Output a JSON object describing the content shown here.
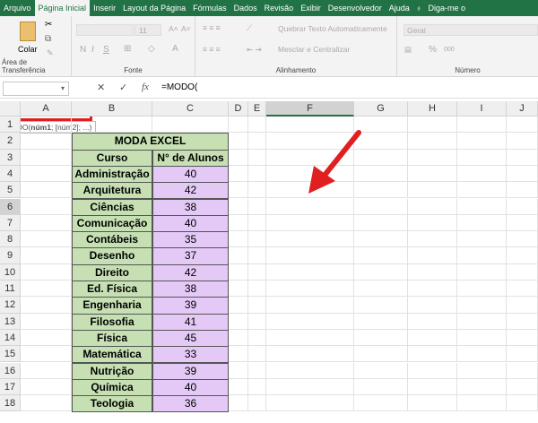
{
  "tabs": [
    "Arquivo",
    "Página Inicial",
    "Inserir",
    "Layout da Página",
    "Fórmulas",
    "Dados",
    "Revisão",
    "Exibir",
    "Desenvolvedor",
    "Ajuda",
    "Diga-me o"
  ],
  "ribbon": {
    "paste": "Colar",
    "clipboard": "Área de Transferência",
    "font_size": "11",
    "font": "Fonte",
    "bold": "N",
    "italic": "I",
    "underline": "S",
    "wrap": "Quebrar Texto Automaticamente",
    "merge": "Mesclar e Centralizar",
    "alignment": "Alinhamento",
    "number_format": "Geral",
    "number": "Número",
    "percent": "%",
    "thousands": "000"
  },
  "formula_bar": {
    "name_box": "",
    "fx": "fx",
    "formula": "=MODO("
  },
  "columns": [
    "A",
    "B",
    "C",
    "D",
    "E",
    "F",
    "G",
    "H",
    "I",
    "J"
  ],
  "rows": [
    "1",
    "2",
    "3",
    "4",
    "5",
    "6",
    "7",
    "8",
    "9",
    "10",
    "11",
    "12",
    "13",
    "14",
    "15",
    "16",
    "17",
    "18"
  ],
  "table": {
    "title": "MODA EXCEL",
    "headers": [
      "Curso",
      "N° de Alunos"
    ],
    "data": [
      [
        "Administração",
        "40"
      ],
      [
        "Arquitetura",
        "42"
      ],
      [
        "Ciências",
        "38"
      ],
      [
        "Comunicação",
        "40"
      ],
      [
        "Contábeis",
        "35"
      ],
      [
        "Desenho",
        "37"
      ],
      [
        "Direito",
        "42"
      ],
      [
        "Ed. Física",
        "38"
      ],
      [
        "Engenharia",
        "39"
      ],
      [
        "Filosofia",
        "41"
      ],
      [
        "Física",
        "45"
      ],
      [
        "Matemática",
        "33"
      ],
      [
        "Nutrição",
        "39"
      ],
      [
        "Química",
        "40"
      ],
      [
        "Teologia",
        "36"
      ]
    ]
  },
  "active_cell": {
    "value": "=MODO(",
    "tooltip_fn": "MODO(",
    "tooltip_arg1": "núm1",
    "tooltip_rest": "; [núm2]; ...)"
  },
  "colors": {
    "accent": "#217346",
    "header_fill": "#c6e0b4",
    "value_fill": "#e4c9f7",
    "highlight": "#e02020"
  }
}
